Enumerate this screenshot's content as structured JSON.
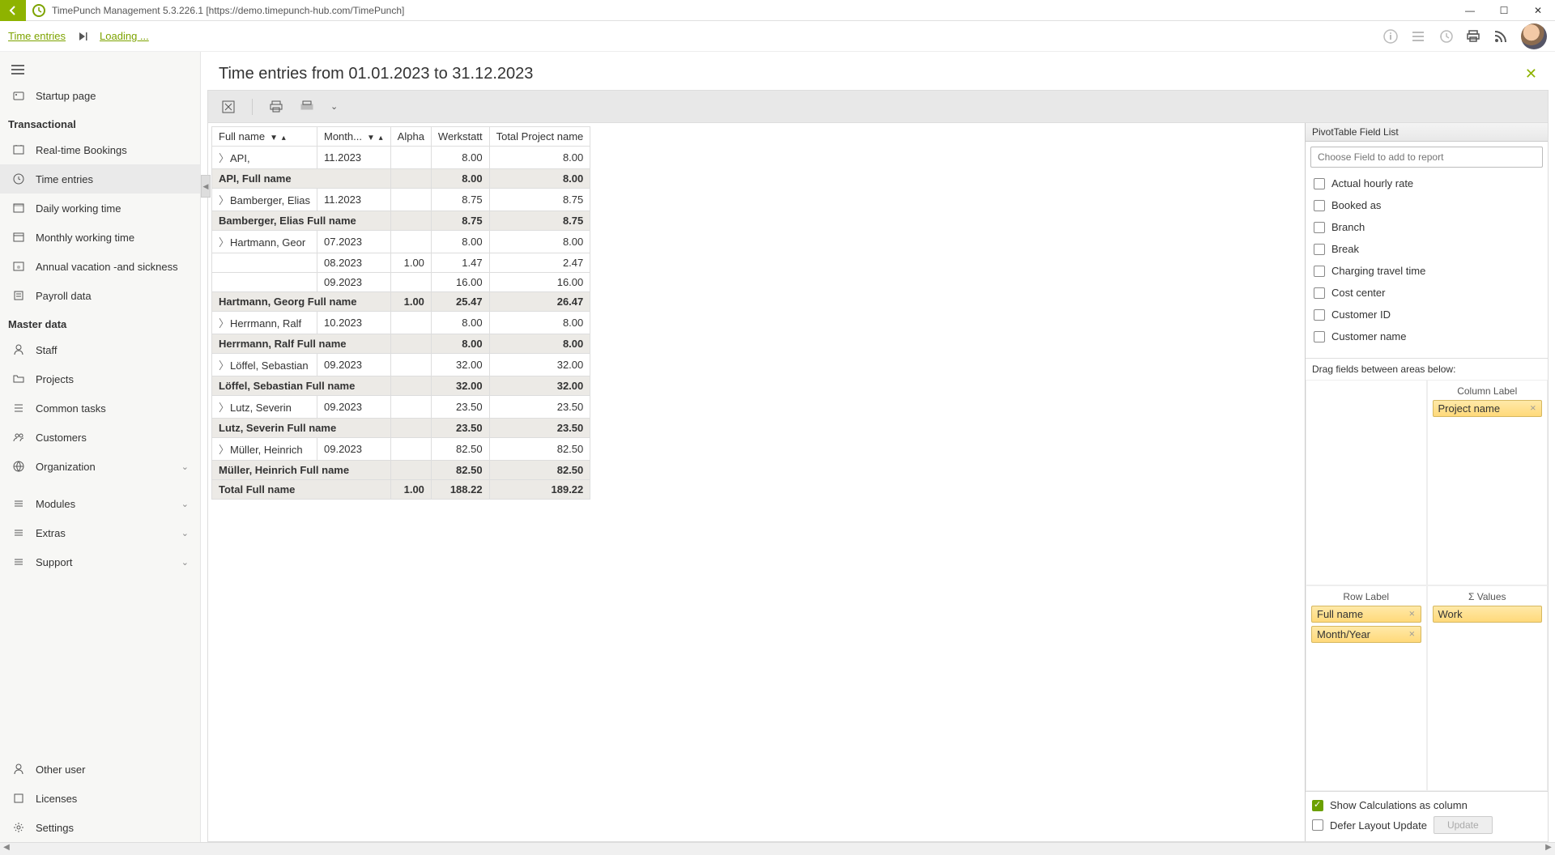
{
  "window": {
    "title": "TimePunch Management 5.3.226.1 [https://demo.timepunch-hub.com/TimePunch]"
  },
  "breadcrumb": {
    "time_entries": "Time entries",
    "loading": "Loading ..."
  },
  "sidebar": {
    "startup": "Startup page",
    "section_transactional": "Transactional",
    "realtime": "Real-time Bookings",
    "time_entries": "Time entries",
    "daily": "Daily working time",
    "monthly": "Monthly working time",
    "vacation": "Annual vacation -and sickness",
    "payroll": "Payroll data",
    "section_master": "Master data",
    "staff": "Staff",
    "projects": "Projects",
    "common_tasks": "Common tasks",
    "customers": "Customers",
    "organization": "Organization",
    "modules": "Modules",
    "extras": "Extras",
    "support": "Support",
    "other_user": "Other user",
    "licenses": "Licenses",
    "settings": "Settings"
  },
  "content": {
    "title": "Time entries from 01.01.2023 to 31.12.2023"
  },
  "pivot": {
    "col_fullname": "Full name",
    "col_month": "Month...",
    "col_alpha": "Alpha",
    "col_werkstatt": "Werkstatt",
    "col_total": "Total Project name",
    "rows": [
      {
        "type": "data",
        "name": "API,",
        "month": "11.2023",
        "alpha": "",
        "werk": "8.00",
        "total": "8.00",
        "exp": true
      },
      {
        "type": "sub",
        "label": "API, Full name",
        "alpha": "",
        "werk": "8.00",
        "total": "8.00"
      },
      {
        "type": "data",
        "name": "Bamberger, Elias",
        "month": "11.2023",
        "alpha": "",
        "werk": "8.75",
        "total": "8.75",
        "exp": true
      },
      {
        "type": "sub",
        "label": "Bamberger, Elias Full name",
        "alpha": "",
        "werk": "8.75",
        "total": "8.75"
      },
      {
        "type": "data",
        "name": "Hartmann, Geor",
        "month": "07.2023",
        "alpha": "",
        "werk": "8.00",
        "total": "8.00",
        "exp": true
      },
      {
        "type": "data",
        "name": "",
        "month": "08.2023",
        "alpha": "1.00",
        "werk": "1.47",
        "total": "2.47"
      },
      {
        "type": "data",
        "name": "",
        "month": "09.2023",
        "alpha": "",
        "werk": "16.00",
        "total": "16.00"
      },
      {
        "type": "sub",
        "label": "Hartmann, Georg Full name",
        "alpha": "1.00",
        "werk": "25.47",
        "total": "26.47"
      },
      {
        "type": "data",
        "name": "Herrmann, Ralf",
        "month": "10.2023",
        "alpha": "",
        "werk": "8.00",
        "total": "8.00",
        "exp": true
      },
      {
        "type": "sub",
        "label": "Herrmann, Ralf Full name",
        "alpha": "",
        "werk": "8.00",
        "total": "8.00"
      },
      {
        "type": "data",
        "name": "Löffel, Sebastian",
        "month": "09.2023",
        "alpha": "",
        "werk": "32.00",
        "total": "32.00",
        "exp": true
      },
      {
        "type": "sub",
        "label": "Löffel, Sebastian Full name",
        "alpha": "",
        "werk": "32.00",
        "total": "32.00"
      },
      {
        "type": "data",
        "name": "Lutz, Severin",
        "month": "09.2023",
        "alpha": "",
        "werk": "23.50",
        "total": "23.50",
        "exp": true
      },
      {
        "type": "sub",
        "label": "Lutz, Severin Full name",
        "alpha": "",
        "werk": "23.50",
        "total": "23.50"
      },
      {
        "type": "data",
        "name": "Müller, Heinrich",
        "month": "09.2023",
        "alpha": "",
        "werk": "82.50",
        "total": "82.50",
        "exp": true
      },
      {
        "type": "sub",
        "label": "Müller, Heinrich Full name",
        "alpha": "",
        "werk": "82.50",
        "total": "82.50"
      },
      {
        "type": "grand",
        "label": "Total Full name",
        "alpha": "1.00",
        "werk": "188.22",
        "total": "189.22"
      }
    ]
  },
  "fieldlist": {
    "title": "PivotTable Field List",
    "search_placeholder": "Choose Field to add to report",
    "fields": [
      "Actual hourly rate",
      "Booked as",
      "Branch",
      "Break",
      "Charging travel time",
      "Cost center",
      "Customer ID",
      "Customer name"
    ],
    "drag_label": "Drag fields between areas below:",
    "area_filter": "",
    "area_column": "Column Label",
    "area_row": "Row Label",
    "area_values": "Σ  Values",
    "chip_project": "Project name",
    "chip_fullname": "Full name",
    "chip_month": "Month/Year",
    "chip_work": "Work",
    "show_calc": "Show Calculations as column",
    "defer": "Defer Layout Update",
    "update": "Update"
  }
}
